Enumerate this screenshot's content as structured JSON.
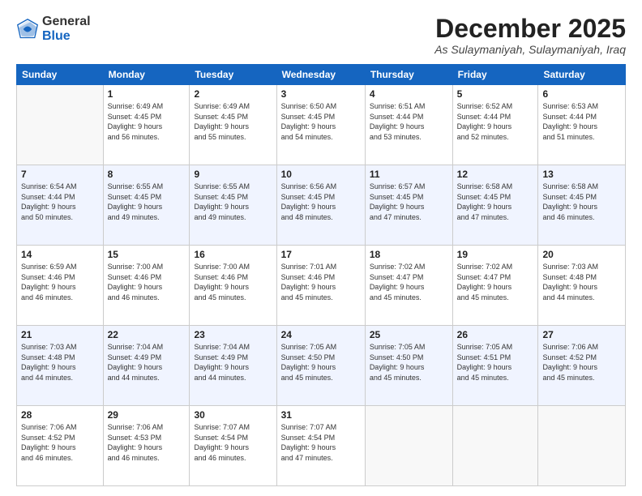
{
  "logo": {
    "general": "General",
    "blue": "Blue"
  },
  "header": {
    "month": "December 2025",
    "location": "As Sulaymaniyah, Sulaymaniyah, Iraq"
  },
  "weekdays": [
    "Sunday",
    "Monday",
    "Tuesday",
    "Wednesday",
    "Thursday",
    "Friday",
    "Saturday"
  ],
  "weeks": [
    [
      {
        "day": "",
        "sunrise": "",
        "sunset": "",
        "daylight": ""
      },
      {
        "day": "1",
        "sunrise": "Sunrise: 6:49 AM",
        "sunset": "Sunset: 4:45 PM",
        "daylight": "Daylight: 9 hours and 56 minutes."
      },
      {
        "day": "2",
        "sunrise": "Sunrise: 6:49 AM",
        "sunset": "Sunset: 4:45 PM",
        "daylight": "Daylight: 9 hours and 55 minutes."
      },
      {
        "day": "3",
        "sunrise": "Sunrise: 6:50 AM",
        "sunset": "Sunset: 4:45 PM",
        "daylight": "Daylight: 9 hours and 54 minutes."
      },
      {
        "day": "4",
        "sunrise": "Sunrise: 6:51 AM",
        "sunset": "Sunset: 4:44 PM",
        "daylight": "Daylight: 9 hours and 53 minutes."
      },
      {
        "day": "5",
        "sunrise": "Sunrise: 6:52 AM",
        "sunset": "Sunset: 4:44 PM",
        "daylight": "Daylight: 9 hours and 52 minutes."
      },
      {
        "day": "6",
        "sunrise": "Sunrise: 6:53 AM",
        "sunset": "Sunset: 4:44 PM",
        "daylight": "Daylight: 9 hours and 51 minutes."
      }
    ],
    [
      {
        "day": "7",
        "sunrise": "Sunrise: 6:54 AM",
        "sunset": "Sunset: 4:44 PM",
        "daylight": "Daylight: 9 hours and 50 minutes."
      },
      {
        "day": "8",
        "sunrise": "Sunrise: 6:55 AM",
        "sunset": "Sunset: 4:45 PM",
        "daylight": "Daylight: 9 hours and 49 minutes."
      },
      {
        "day": "9",
        "sunrise": "Sunrise: 6:55 AM",
        "sunset": "Sunset: 4:45 PM",
        "daylight": "Daylight: 9 hours and 49 minutes."
      },
      {
        "day": "10",
        "sunrise": "Sunrise: 6:56 AM",
        "sunset": "Sunset: 4:45 PM",
        "daylight": "Daylight: 9 hours and 48 minutes."
      },
      {
        "day": "11",
        "sunrise": "Sunrise: 6:57 AM",
        "sunset": "Sunset: 4:45 PM",
        "daylight": "Daylight: 9 hours and 47 minutes."
      },
      {
        "day": "12",
        "sunrise": "Sunrise: 6:58 AM",
        "sunset": "Sunset: 4:45 PM",
        "daylight": "Daylight: 9 hours and 47 minutes."
      },
      {
        "day": "13",
        "sunrise": "Sunrise: 6:58 AM",
        "sunset": "Sunset: 4:45 PM",
        "daylight": "Daylight: 9 hours and 46 minutes."
      }
    ],
    [
      {
        "day": "14",
        "sunrise": "Sunrise: 6:59 AM",
        "sunset": "Sunset: 4:46 PM",
        "daylight": "Daylight: 9 hours and 46 minutes."
      },
      {
        "day": "15",
        "sunrise": "Sunrise: 7:00 AM",
        "sunset": "Sunset: 4:46 PM",
        "daylight": "Daylight: 9 hours and 46 minutes."
      },
      {
        "day": "16",
        "sunrise": "Sunrise: 7:00 AM",
        "sunset": "Sunset: 4:46 PM",
        "daylight": "Daylight: 9 hours and 45 minutes."
      },
      {
        "day": "17",
        "sunrise": "Sunrise: 7:01 AM",
        "sunset": "Sunset: 4:46 PM",
        "daylight": "Daylight: 9 hours and 45 minutes."
      },
      {
        "day": "18",
        "sunrise": "Sunrise: 7:02 AM",
        "sunset": "Sunset: 4:47 PM",
        "daylight": "Daylight: 9 hours and 45 minutes."
      },
      {
        "day": "19",
        "sunrise": "Sunrise: 7:02 AM",
        "sunset": "Sunset: 4:47 PM",
        "daylight": "Daylight: 9 hours and 45 minutes."
      },
      {
        "day": "20",
        "sunrise": "Sunrise: 7:03 AM",
        "sunset": "Sunset: 4:48 PM",
        "daylight": "Daylight: 9 hours and 44 minutes."
      }
    ],
    [
      {
        "day": "21",
        "sunrise": "Sunrise: 7:03 AM",
        "sunset": "Sunset: 4:48 PM",
        "daylight": "Daylight: 9 hours and 44 minutes."
      },
      {
        "day": "22",
        "sunrise": "Sunrise: 7:04 AM",
        "sunset": "Sunset: 4:49 PM",
        "daylight": "Daylight: 9 hours and 44 minutes."
      },
      {
        "day": "23",
        "sunrise": "Sunrise: 7:04 AM",
        "sunset": "Sunset: 4:49 PM",
        "daylight": "Daylight: 9 hours and 44 minutes."
      },
      {
        "day": "24",
        "sunrise": "Sunrise: 7:05 AM",
        "sunset": "Sunset: 4:50 PM",
        "daylight": "Daylight: 9 hours and 45 minutes."
      },
      {
        "day": "25",
        "sunrise": "Sunrise: 7:05 AM",
        "sunset": "Sunset: 4:50 PM",
        "daylight": "Daylight: 9 hours and 45 minutes."
      },
      {
        "day": "26",
        "sunrise": "Sunrise: 7:05 AM",
        "sunset": "Sunset: 4:51 PM",
        "daylight": "Daylight: 9 hours and 45 minutes."
      },
      {
        "day": "27",
        "sunrise": "Sunrise: 7:06 AM",
        "sunset": "Sunset: 4:52 PM",
        "daylight": "Daylight: 9 hours and 45 minutes."
      }
    ],
    [
      {
        "day": "28",
        "sunrise": "Sunrise: 7:06 AM",
        "sunset": "Sunset: 4:52 PM",
        "daylight": "Daylight: 9 hours and 46 minutes."
      },
      {
        "day": "29",
        "sunrise": "Sunrise: 7:06 AM",
        "sunset": "Sunset: 4:53 PM",
        "daylight": "Daylight: 9 hours and 46 minutes."
      },
      {
        "day": "30",
        "sunrise": "Sunrise: 7:07 AM",
        "sunset": "Sunset: 4:54 PM",
        "daylight": "Daylight: 9 hours and 46 minutes."
      },
      {
        "day": "31",
        "sunrise": "Sunrise: 7:07 AM",
        "sunset": "Sunset: 4:54 PM",
        "daylight": "Daylight: 9 hours and 47 minutes."
      },
      {
        "day": "",
        "sunrise": "",
        "sunset": "",
        "daylight": ""
      },
      {
        "day": "",
        "sunrise": "",
        "sunset": "",
        "daylight": ""
      },
      {
        "day": "",
        "sunrise": "",
        "sunset": "",
        "daylight": ""
      }
    ]
  ]
}
